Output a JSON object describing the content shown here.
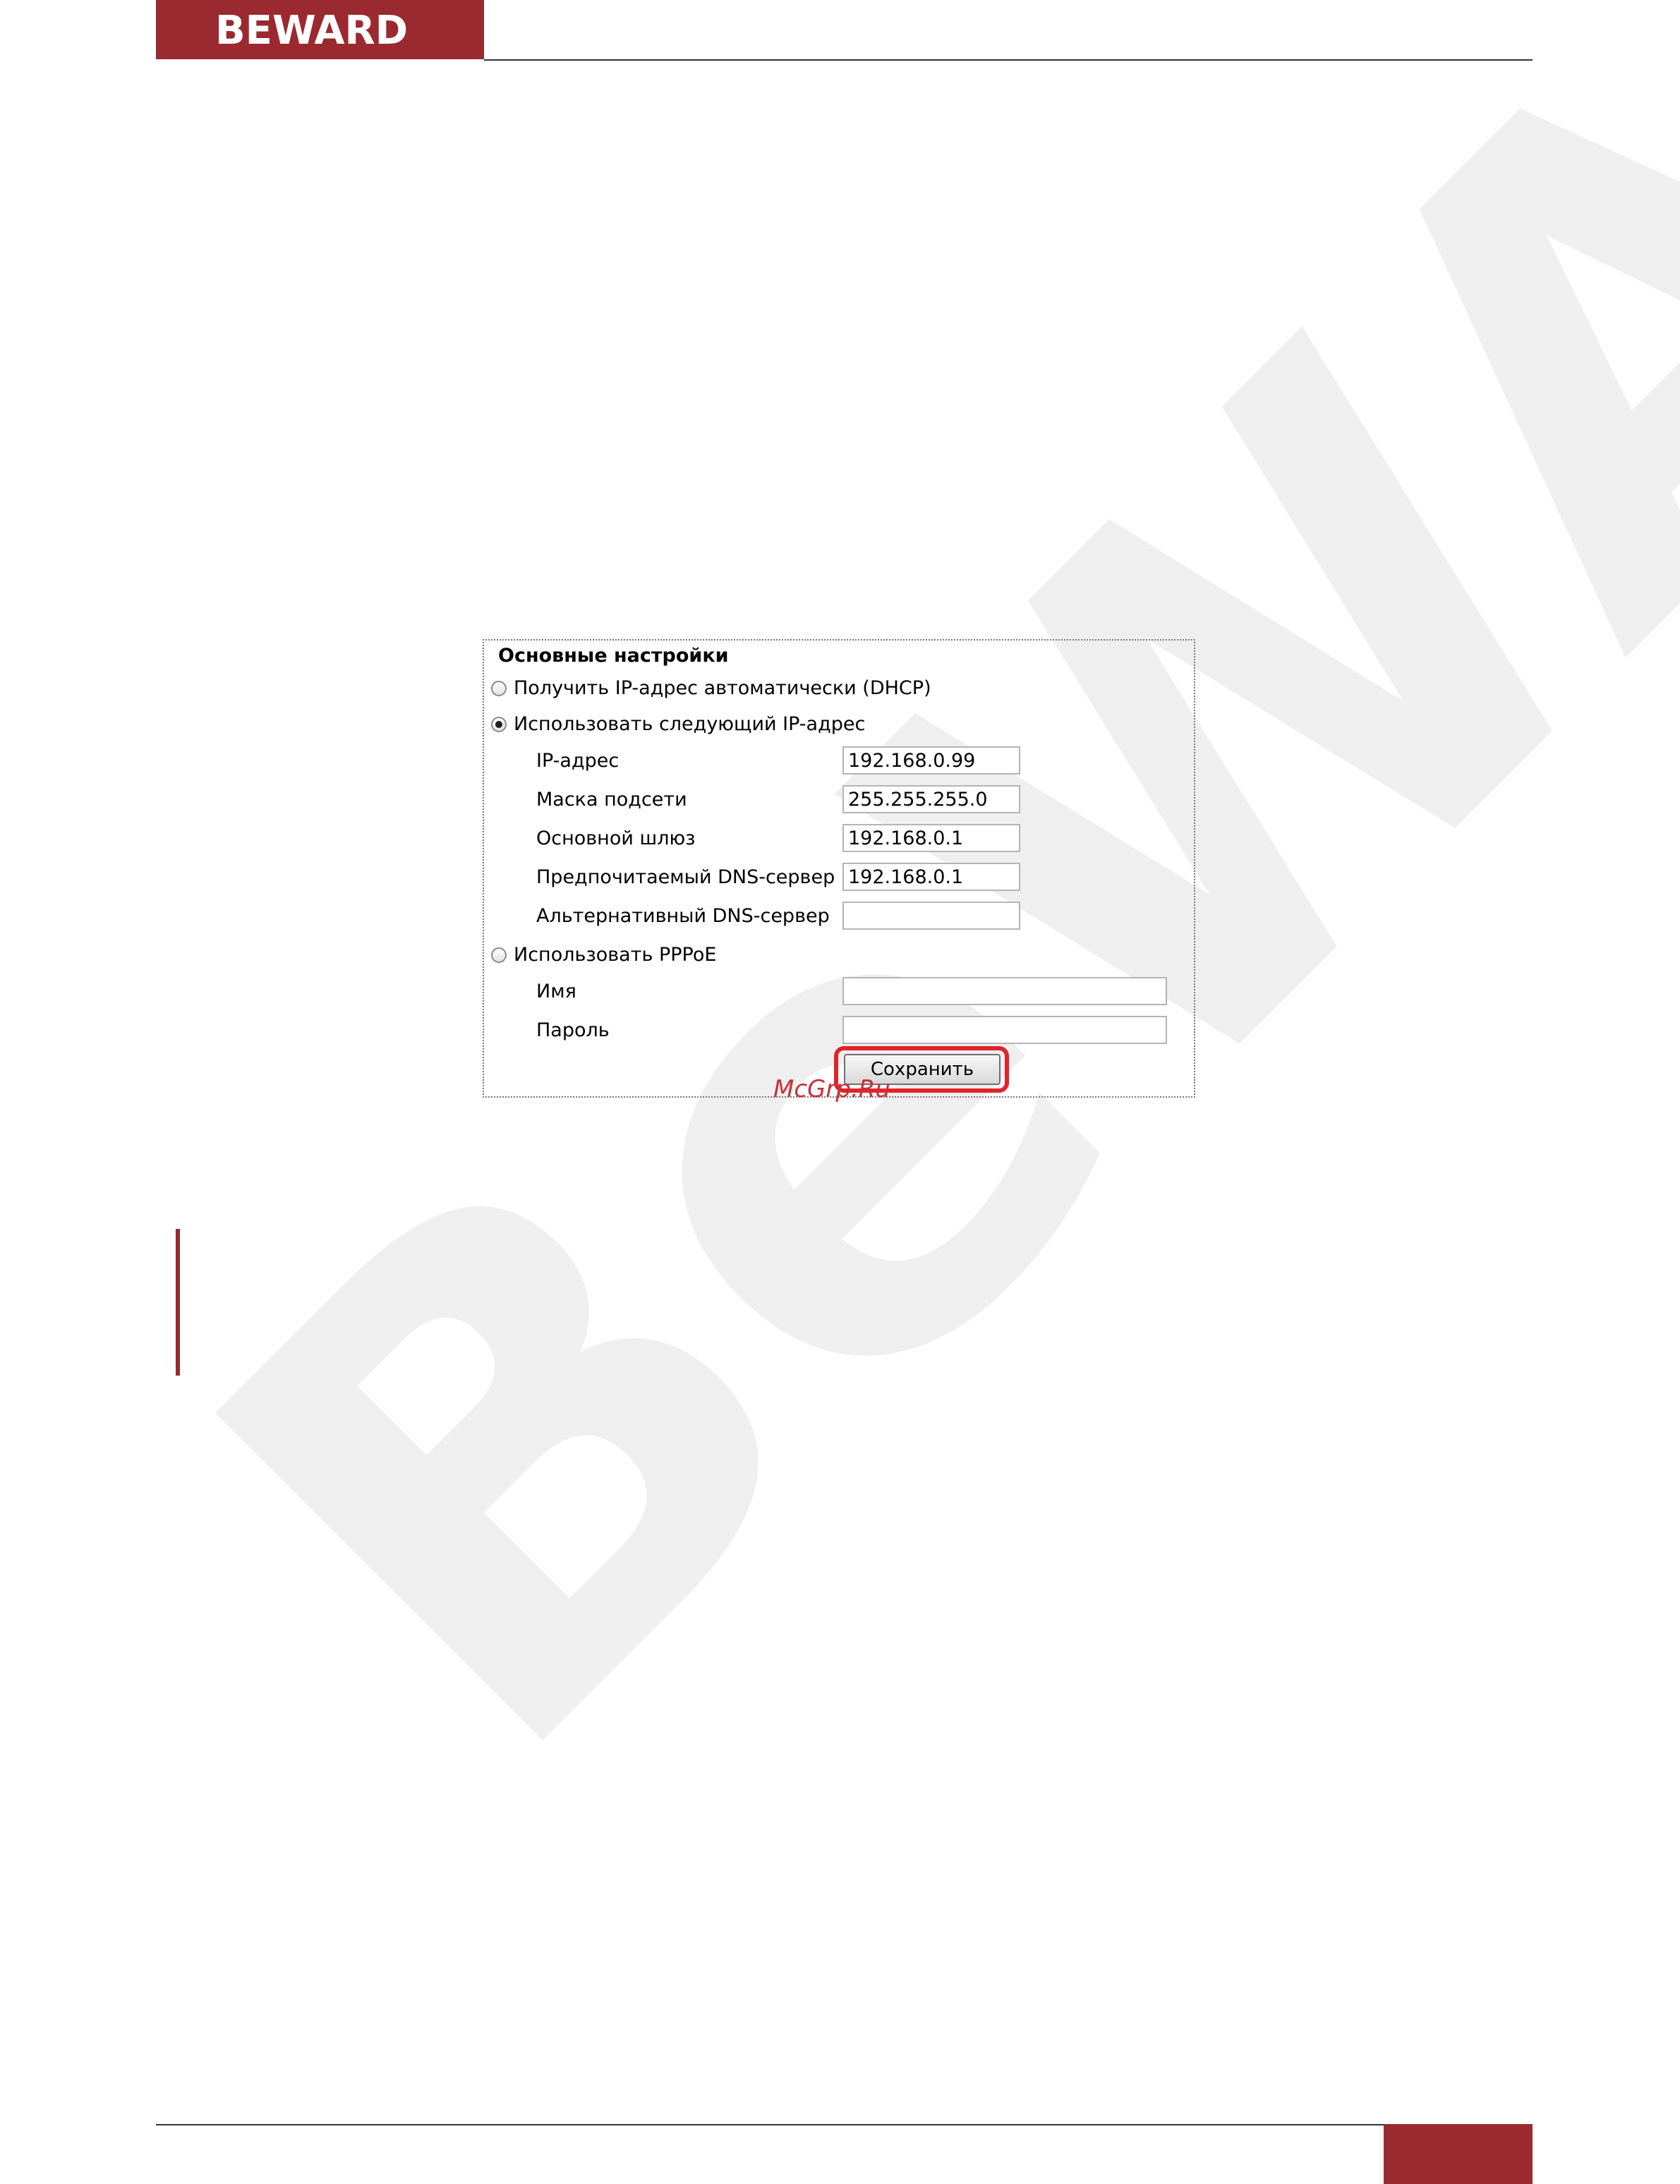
{
  "header": {
    "brand": "BEWARD"
  },
  "colors": {
    "brand": "#9b2a30",
    "highlight": "#e3232a"
  },
  "panel": {
    "title": "Основные настройки",
    "options": [
      {
        "label": "Получить IP-адрес автоматически (DHCP)",
        "selected": false
      },
      {
        "label": "Использовать следующий IP-адрес",
        "selected": true
      },
      {
        "label": "Использовать PPPoE",
        "selected": false
      }
    ],
    "fields": {
      "ip": {
        "label": "IP-адрес",
        "value": "192.168.0.99"
      },
      "mask": {
        "label": "Маска подсети",
        "value": "255.255.255.0"
      },
      "gateway": {
        "label": "Основной шлюз",
        "value": "192.168.0.1"
      },
      "dns1": {
        "label": "Предпочитаемый DNS-сервер",
        "value": "192.168.0.1"
      },
      "dns2": {
        "label": "Альтернативный DNS-сервер",
        "value": ""
      },
      "name": {
        "label": "Имя",
        "value": ""
      },
      "password": {
        "label": "Пароль",
        "value": ""
      }
    },
    "save_label": "Сохранить"
  },
  "site_mark": "McGrp.Ru"
}
